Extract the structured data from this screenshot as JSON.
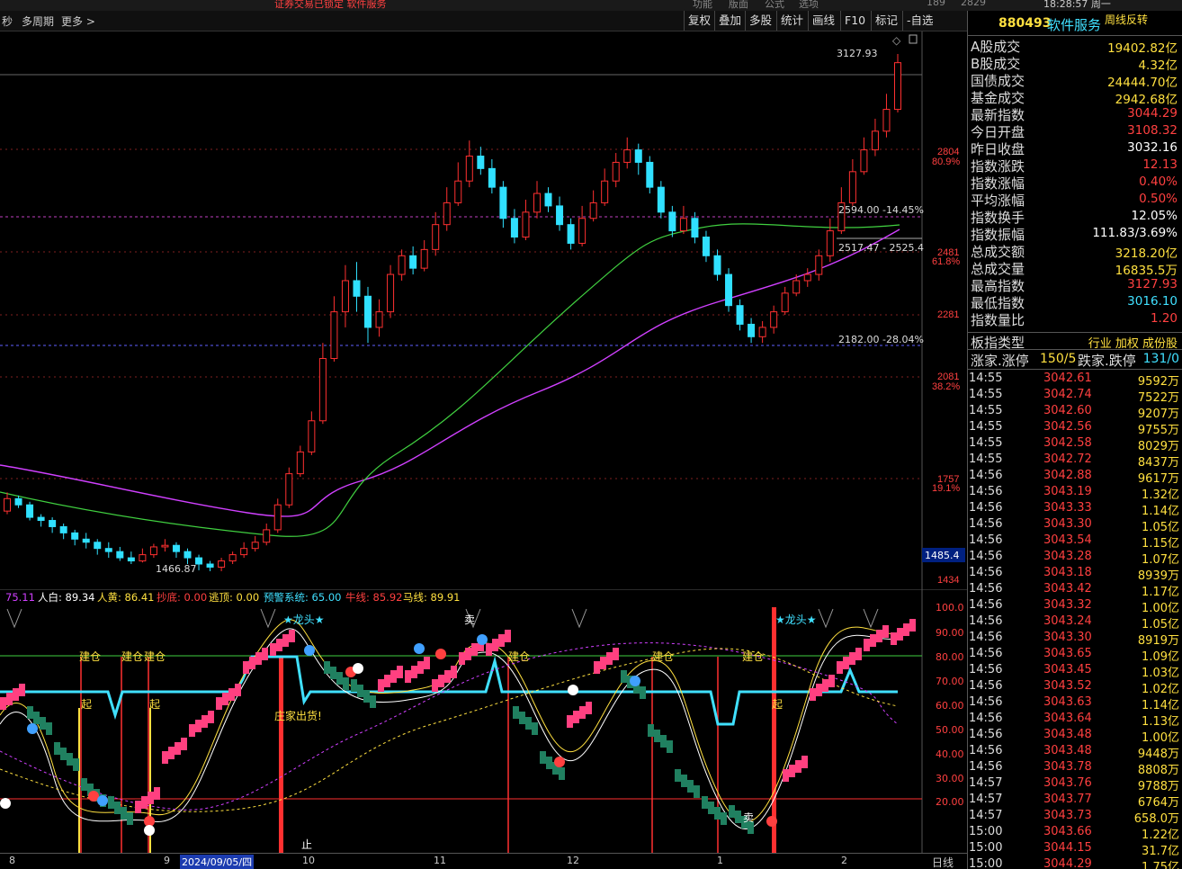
{
  "top": {
    "a": "证券交易已锁定  软件服务",
    "b": "功能",
    "c": "版面",
    "d": "公式",
    "e": "选项",
    "f": "189",
    "g": "2829",
    "time": "18:28:57 周一"
  },
  "toolbar": {
    "left": [
      "秒",
      "多周期",
      "更多 >"
    ],
    "buttons": [
      "复权",
      "叠加",
      "多股",
      "统计",
      "画线",
      "F10",
      "标记",
      "-自选"
    ]
  },
  "header": {
    "code": "880493",
    "name": "软件服务",
    "tag": "周线反转"
  },
  "main_chart": {
    "price_labels": [
      "2804",
      "2481",
      "2281",
      "2081",
      "1757",
      "1434"
    ],
    "pct_labels": [
      "80.9%",
      "61.8%",
      "38.2%",
      "19.1%"
    ],
    "current_price_box": "1485.4",
    "annotations": {
      "high": "3127.93",
      "fib1": "2594.00 -14.45%",
      "fib2": "2517.47 - 2525.4",
      "fib3": "2182.00 -28.04%",
      "low": "1466.87"
    }
  },
  "chart_data": {
    "type": "candlestick",
    "candles": [
      [
        1660,
        1700,
        1650,
        1720
      ],
      [
        1700,
        1680,
        1670,
        1710
      ],
      [
        1680,
        1640,
        1630,
        1690
      ],
      [
        1640,
        1630,
        1610,
        1650
      ],
      [
        1630,
        1610,
        1590,
        1640
      ],
      [
        1610,
        1590,
        1570,
        1620
      ],
      [
        1590,
        1570,
        1550,
        1600
      ],
      [
        1570,
        1560,
        1540,
        1590
      ],
      [
        1560,
        1540,
        1520,
        1570
      ],
      [
        1540,
        1530,
        1510,
        1560
      ],
      [
        1530,
        1510,
        1500,
        1545
      ],
      [
        1510,
        1500,
        1490,
        1530
      ],
      [
        1500,
        1520,
        1495,
        1540
      ],
      [
        1520,
        1545,
        1510,
        1555
      ],
      [
        1545,
        1550,
        1530,
        1570
      ],
      [
        1550,
        1530,
        1510,
        1560
      ],
      [
        1530,
        1510,
        1490,
        1540
      ],
      [
        1510,
        1490,
        1470,
        1520
      ],
      [
        1490,
        1480,
        1467,
        1500
      ],
      [
        1480,
        1500,
        1467,
        1510
      ],
      [
        1500,
        1520,
        1490,
        1530
      ],
      [
        1520,
        1540,
        1510,
        1560
      ],
      [
        1540,
        1560,
        1530,
        1580
      ],
      [
        1560,
        1600,
        1550,
        1620
      ],
      [
        1600,
        1680,
        1590,
        1700
      ],
      [
        1680,
        1780,
        1670,
        1800
      ],
      [
        1780,
        1850,
        1770,
        1870
      ],
      [
        1850,
        1950,
        1840,
        1980
      ],
      [
        1950,
        2150,
        1940,
        2200
      ],
      [
        2150,
        2300,
        2140,
        2350
      ],
      [
        2300,
        2400,
        2250,
        2450
      ],
      [
        2400,
        2350,
        2300,
        2460
      ],
      [
        2350,
        2250,
        2200,
        2380
      ],
      [
        2250,
        2300,
        2220,
        2340
      ],
      [
        2300,
        2420,
        2280,
        2450
      ],
      [
        2420,
        2480,
        2400,
        2500
      ],
      [
        2480,
        2440,
        2420,
        2510
      ],
      [
        2440,
        2500,
        2430,
        2530
      ],
      [
        2500,
        2580,
        2480,
        2620
      ],
      [
        2580,
        2650,
        2560,
        2700
      ],
      [
        2650,
        2720,
        2640,
        2780
      ],
      [
        2720,
        2800,
        2700,
        2850
      ],
      [
        2800,
        2760,
        2740,
        2830
      ],
      [
        2760,
        2700,
        2680,
        2790
      ],
      [
        2700,
        2600,
        2570,
        2720
      ],
      [
        2600,
        2540,
        2520,
        2630
      ],
      [
        2540,
        2620,
        2530,
        2660
      ],
      [
        2620,
        2680,
        2600,
        2720
      ],
      [
        2680,
        2640,
        2620,
        2700
      ],
      [
        2640,
        2580,
        2560,
        2670
      ],
      [
        2580,
        2520,
        2500,
        2600
      ],
      [
        2520,
        2600,
        2510,
        2640
      ],
      [
        2600,
        2650,
        2590,
        2690
      ],
      [
        2650,
        2720,
        2640,
        2760
      ],
      [
        2720,
        2780,
        2700,
        2810
      ],
      [
        2780,
        2820,
        2760,
        2860
      ],
      [
        2820,
        2780,
        2740,
        2840
      ],
      [
        2780,
        2700,
        2680,
        2800
      ],
      [
        2700,
        2620,
        2600,
        2720
      ],
      [
        2620,
        2560,
        2540,
        2640
      ],
      [
        2560,
        2600,
        2550,
        2640
      ],
      [
        2600,
        2540,
        2520,
        2620
      ],
      [
        2540,
        2480,
        2460,
        2560
      ],
      [
        2480,
        2420,
        2400,
        2500
      ],
      [
        2420,
        2320,
        2300,
        2440
      ],
      [
        2320,
        2260,
        2240,
        2340
      ],
      [
        2260,
        2220,
        2200,
        2280
      ],
      [
        2220,
        2250,
        2200,
        2270
      ],
      [
        2250,
        2300,
        2230,
        2320
      ],
      [
        2300,
        2360,
        2290,
        2380
      ],
      [
        2360,
        2400,
        2350,
        2420
      ],
      [
        2400,
        2420,
        2380,
        2440
      ],
      [
        2420,
        2480,
        2400,
        2500
      ],
      [
        2480,
        2560,
        2460,
        2600
      ],
      [
        2560,
        2650,
        2550,
        2700
      ],
      [
        2650,
        2750,
        2640,
        2790
      ],
      [
        2750,
        2820,
        2740,
        2860
      ],
      [
        2820,
        2880,
        2800,
        2920
      ],
      [
        2880,
        2950,
        2860,
        3000
      ],
      [
        2950,
        3100,
        2940,
        3127.93
      ]
    ]
  },
  "indicator": {
    "legend": [
      {
        "t": "75.11",
        "c": "#d040ff"
      },
      {
        "t": "人白: 89.34",
        "c": "#ffffff"
      },
      {
        "t": "人黄: 86.41",
        "c": "#ffe040"
      },
      {
        "t": "抄底: 0.00",
        "c": "#ff4040"
      },
      {
        "t": "逃顶: 0.00",
        "c": "#ffe040"
      },
      {
        "t": "预警系统: 65.00",
        "c": "#40e0ff"
      },
      {
        "t": "牛线: 85.92",
        "c": "#ff4040"
      },
      {
        "t": "马线: 89.91",
        "c": "#ffe040"
      }
    ],
    "levels": [
      "100.0",
      "90.00",
      "80.00",
      "70.00",
      "60.00",
      "50.00",
      "40.00",
      "30.00",
      "20.00"
    ],
    "labels": {
      "jc": "建仓",
      "qi": "起",
      "sell": "卖",
      "buy": "买",
      "dz": "庄家出货!",
      "lt": "★龙头★",
      "zhi": "止"
    }
  },
  "axis": {
    "ticks": [
      "8",
      "9",
      "2024/09/05/四",
      "10",
      "11",
      "12",
      "1",
      "2"
    ],
    "period": "日线"
  },
  "quote": [
    {
      "k": "A股成交",
      "v": "19402.82亿",
      "c": "yel"
    },
    {
      "k": "B股成交",
      "v": "4.32亿",
      "c": "yel"
    },
    {
      "k": "国债成交",
      "v": "24444.70亿",
      "c": "yel"
    },
    {
      "k": "基金成交",
      "v": "2942.68亿",
      "c": "yel"
    },
    {
      "k": "最新指数",
      "v": "3044.29",
      "c": "red"
    },
    {
      "k": "今日开盘",
      "v": "3108.32",
      "c": "red"
    },
    {
      "k": "昨日收盘",
      "v": "3032.16",
      "c": "wht"
    },
    {
      "k": "指数涨跌",
      "v": "12.13",
      "c": "red"
    },
    {
      "k": "指数涨幅",
      "v": "0.40%",
      "c": "red"
    },
    {
      "k": "平均涨幅",
      "v": "0.50%",
      "c": "red"
    },
    {
      "k": "指数换手",
      "v": "12.05%",
      "c": "wht"
    },
    {
      "k": "指数振幅",
      "v": "111.83/3.69%",
      "c": "wht"
    },
    {
      "k": "总成交额",
      "v": "3218.20亿",
      "c": "yel"
    },
    {
      "k": "总成交量",
      "v": "16835.5万",
      "c": "yel"
    },
    {
      "k": "最高指数",
      "v": "3127.93",
      "c": "red"
    },
    {
      "k": "最低指数",
      "v": "3016.10",
      "c": "cyan"
    },
    {
      "k": "指数量比",
      "v": "1.20",
      "c": "red"
    }
  ],
  "board": {
    "k": "板指类型",
    "v": "行业 加权 成份股"
  },
  "limits": {
    "k1": "涨家.涨停",
    "v1": "150/5",
    "k2": "跌家.跌停",
    "v2": "131/0"
  },
  "ticks": [
    [
      "14:55",
      "3042.61",
      "9592万"
    ],
    [
      "14:55",
      "3042.74",
      "7522万"
    ],
    [
      "14:55",
      "3042.60",
      "9207万"
    ],
    [
      "14:55",
      "3042.56",
      "9755万"
    ],
    [
      "14:55",
      "3042.58",
      "8029万"
    ],
    [
      "14:55",
      "3042.72",
      "8437万"
    ],
    [
      "14:56",
      "3042.88",
      "9617万"
    ],
    [
      "14:56",
      "3043.19",
      "1.32亿"
    ],
    [
      "14:56",
      "3043.33",
      "1.14亿"
    ],
    [
      "14:56",
      "3043.30",
      "1.05亿"
    ],
    [
      "14:56",
      "3043.54",
      "1.15亿"
    ],
    [
      "14:56",
      "3043.28",
      "1.07亿"
    ],
    [
      "14:56",
      "3043.18",
      "8939万"
    ],
    [
      "14:56",
      "3043.42",
      "1.17亿"
    ],
    [
      "14:56",
      "3043.32",
      "1.00亿"
    ],
    [
      "14:56",
      "3043.24",
      "1.05亿"
    ],
    [
      "14:56",
      "3043.30",
      "8919万"
    ],
    [
      "14:56",
      "3043.65",
      "1.09亿"
    ],
    [
      "14:56",
      "3043.45",
      "1.03亿"
    ],
    [
      "14:56",
      "3043.52",
      "1.02亿"
    ],
    [
      "14:56",
      "3043.63",
      "1.14亿"
    ],
    [
      "14:56",
      "3043.64",
      "1.13亿"
    ],
    [
      "14:56",
      "3043.48",
      "1.00亿"
    ],
    [
      "14:56",
      "3043.48",
      "9448万"
    ],
    [
      "14:56",
      "3043.78",
      "8808万"
    ],
    [
      "14:57",
      "3043.76",
      "9788万"
    ],
    [
      "14:57",
      "3043.77",
      "6764万"
    ],
    [
      "14:57",
      "3043.73",
      "658.0万"
    ],
    [
      "15:00",
      "3043.66",
      "1.22亿"
    ],
    [
      "15:00",
      "3044.15",
      "31.7亿"
    ],
    [
      "15:00",
      "3044.29",
      "1.75亿"
    ]
  ]
}
